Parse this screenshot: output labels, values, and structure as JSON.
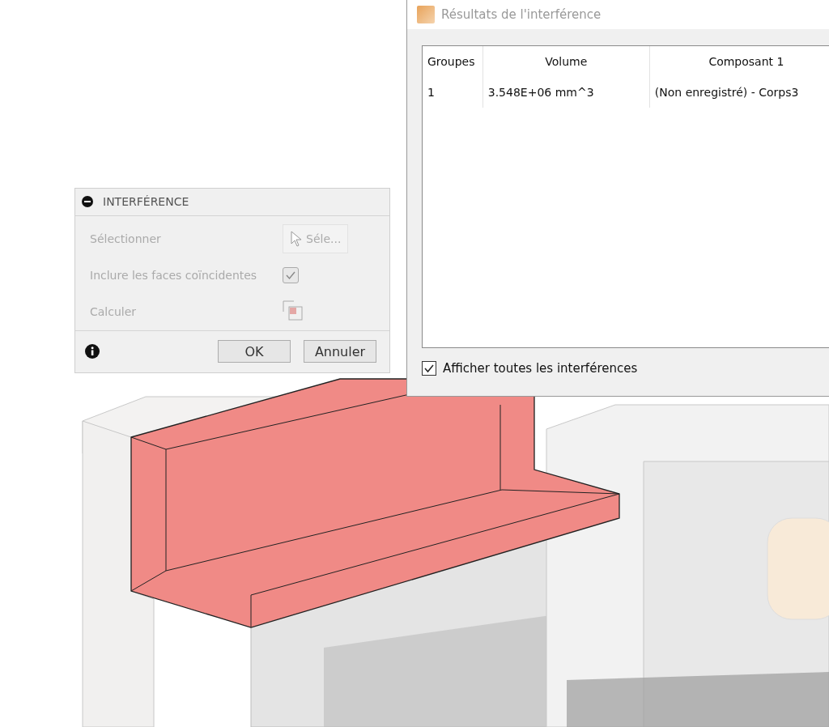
{
  "results_window": {
    "title": "Résultats de l'interférence",
    "table": {
      "columns": [
        "Groupes",
        "Volume",
        "Composant 1"
      ],
      "rows": [
        [
          "1",
          "3.548E+06 mm^3",
          "(Non enregistré) - Corps3"
        ]
      ]
    },
    "show_all": {
      "label": "Afficher toutes les interférences",
      "checked": true
    }
  },
  "panel": {
    "title": "INTERFÉRENCE",
    "rows": [
      {
        "kind": "select",
        "label": "Sélectionner",
        "value": "Séle...",
        "disabled": true
      },
      {
        "kind": "checkbox",
        "label": "Inclure les faces coïncidentes",
        "checked": true,
        "disabled": true
      },
      {
        "kind": "compute",
        "label": "Calculer",
        "disabled": true
      }
    ],
    "buttons": [
      "OK",
      "Annuler"
    ]
  }
}
